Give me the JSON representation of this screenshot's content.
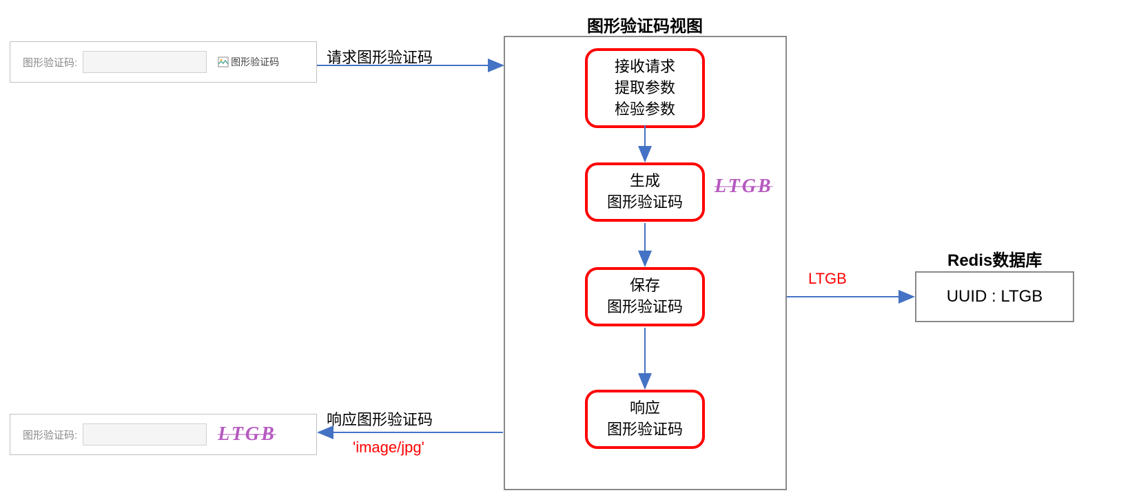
{
  "title": "图形验证码视图",
  "form_top": {
    "label": "图形验证码:",
    "broken_alt": "图形验证码"
  },
  "form_bottom": {
    "label": "图形验证码:",
    "captcha_text": "LTGB"
  },
  "arrows": {
    "request": "请求图形验证码",
    "response": "响应图形验证码",
    "response_type": "'image/jpg'",
    "to_redis": "LTGB"
  },
  "steps": {
    "s1_l1": "接收请求",
    "s1_l2": "提取参数",
    "s1_l3": "检验参数",
    "s2_l1": "生成",
    "s2_l2": "图形验证码",
    "s3_l1": "保存",
    "s3_l2": "图形验证码",
    "s4_l1": "响应",
    "s4_l2": "图形验证码"
  },
  "captcha_sample": "LTGB",
  "redis": {
    "title": "Redis数据库",
    "content": "UUID : LTGB"
  }
}
